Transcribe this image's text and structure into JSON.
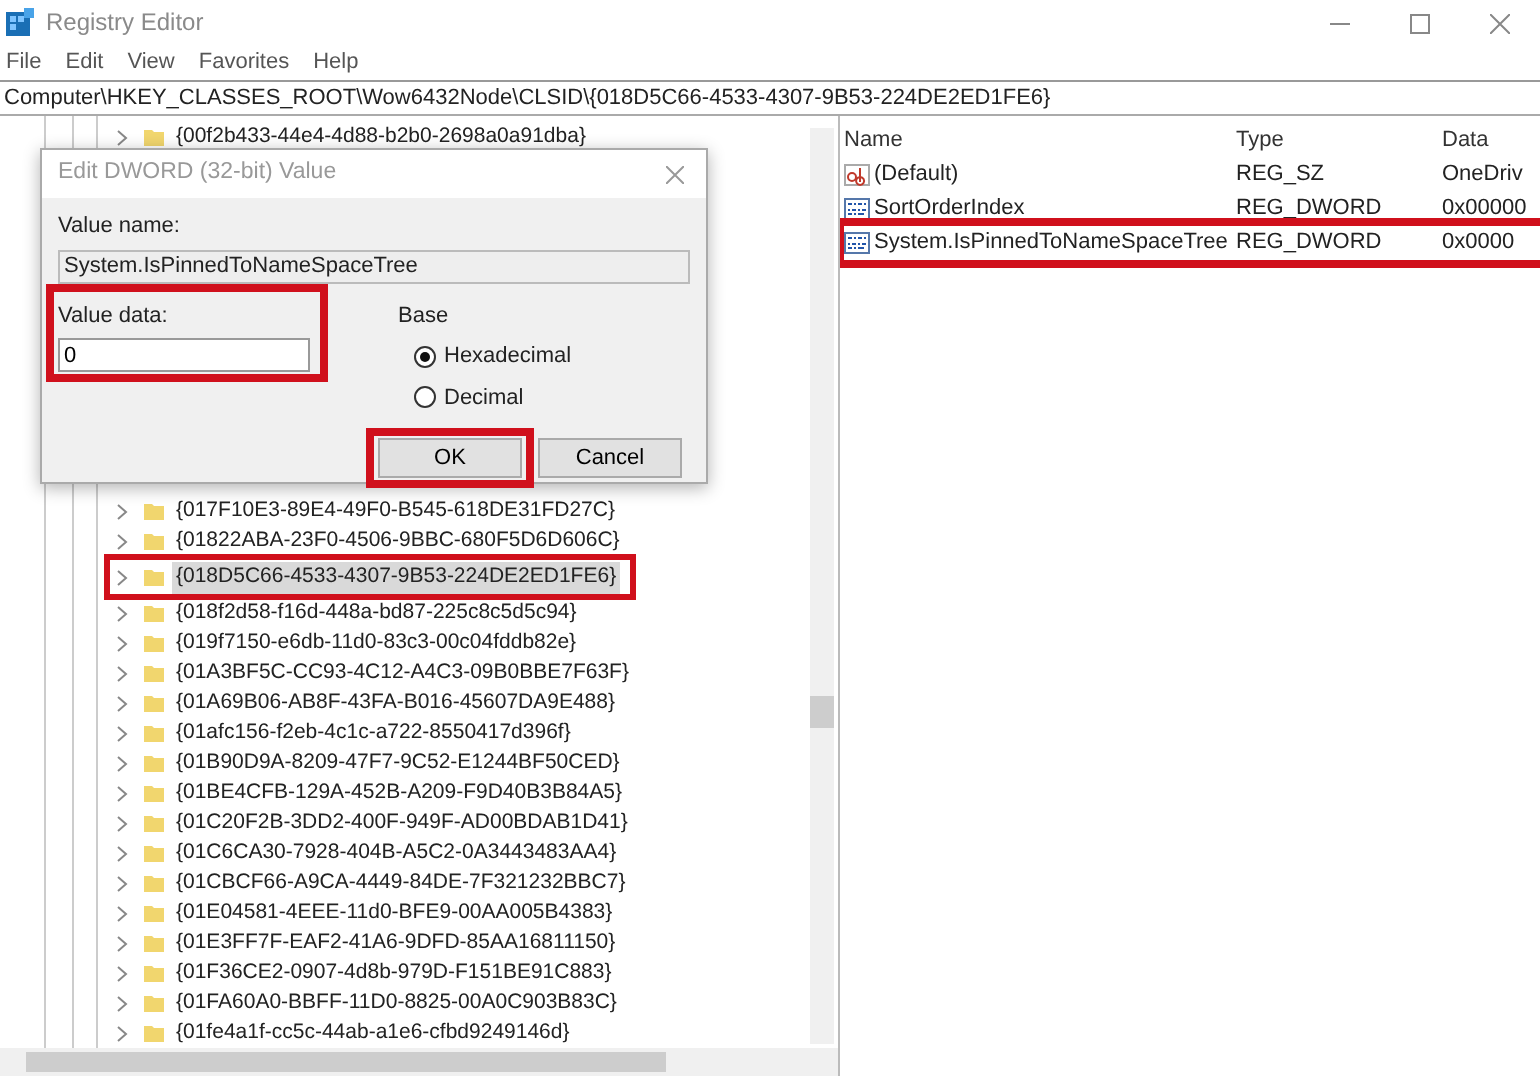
{
  "window": {
    "title": "Registry Editor"
  },
  "menu": [
    "File",
    "Edit",
    "View",
    "Favorites",
    "Help"
  ],
  "address": "Computer\\HKEY_CLASSES_ROOT\\Wow6432Node\\CLSID\\{018D5C66-4533-4307-9B53-224DE2ED1FE6}",
  "tree": [
    {
      "label": "{00f2b433-44e4-4d88-b2b0-2698a0a91dba}",
      "selected": false,
      "highlighted": false
    },
    {
      "label": "{017F10E3-89E4-49F0-B545-618DE31FD27C}",
      "selected": false,
      "highlighted": false
    },
    {
      "label": "{01822ABA-23F0-4506-9BBC-680F5D6D606C}",
      "selected": false,
      "highlighted": false
    },
    {
      "label": "{018D5C66-4533-4307-9B53-224DE2ED1FE6}",
      "selected": true,
      "highlighted": true
    },
    {
      "label": "{018f2d58-f16d-448a-bd87-225c8c5d5c94}",
      "selected": false,
      "highlighted": false
    },
    {
      "label": "{019f7150-e6db-11d0-83c3-00c04fddb82e}",
      "selected": false,
      "highlighted": false
    },
    {
      "label": "{01A3BF5C-CC93-4C12-A4C3-09B0BBE7F63F}",
      "selected": false,
      "highlighted": false
    },
    {
      "label": "{01A69B06-AB8F-43FA-B016-45607DA9E488}",
      "selected": false,
      "highlighted": false
    },
    {
      "label": "{01afc156-f2eb-4c1c-a722-8550417d396f}",
      "selected": false,
      "highlighted": false
    },
    {
      "label": "{01B90D9A-8209-47F7-9C52-E1244BF50CED}",
      "selected": false,
      "highlighted": false
    },
    {
      "label": "{01BE4CFB-129A-452B-A209-F9D40B3B84A5}",
      "selected": false,
      "highlighted": false
    },
    {
      "label": "{01C20F2B-3DD2-400F-949F-AD00BDAB1D41}",
      "selected": false,
      "highlighted": false
    },
    {
      "label": "{01C6CA30-7928-404B-A5C2-0A3443483AA4}",
      "selected": false,
      "highlighted": false
    },
    {
      "label": "{01CBCF66-A9CA-4449-84DE-7F321232BBC7}",
      "selected": false,
      "highlighted": false
    },
    {
      "label": "{01E04581-4EEE-11d0-BFE9-00AA005B4383}",
      "selected": false,
      "highlighted": false
    },
    {
      "label": "{01E3FF7F-EAF2-41A6-9DFD-85AA16811150}",
      "selected": false,
      "highlighted": false
    },
    {
      "label": "{01F36CE2-0907-4d8b-979D-F151BE91C883}",
      "selected": false,
      "highlighted": false
    },
    {
      "label": "{01FA60A0-BBFF-11D0-8825-00A0C903B83C}",
      "selected": false,
      "highlighted": false
    },
    {
      "label": "{01fe4a1f-cc5c-44ab-a1e6-cfbd9249146d}",
      "selected": false,
      "highlighted": false
    }
  ],
  "values": {
    "columns": [
      "Name",
      "Type",
      "Data"
    ],
    "rows": [
      {
        "kind": "string",
        "name": "(Default)",
        "type": "REG_SZ",
        "data": "OneDriv",
        "highlighted": false
      },
      {
        "kind": "binary",
        "name": "SortOrderIndex",
        "type": "REG_DWORD",
        "data": "0x00000",
        "highlighted": false
      },
      {
        "kind": "binary",
        "name": "System.IsPinnedToNameSpaceTree",
        "type": "REG_DWORD",
        "data": "0x0000",
        "highlighted": true
      }
    ]
  },
  "dialog": {
    "title": "Edit DWORD (32-bit) Value",
    "value_name_label": "Value name:",
    "value_name": "System.IsPinnedToNameSpaceTree",
    "value_data_label": "Value data:",
    "value_data": "0",
    "value_data_highlighted": true,
    "base_label": "Base",
    "bases": [
      {
        "label": "Hexadecimal",
        "selected": true
      },
      {
        "label": "Decimal",
        "selected": false
      }
    ],
    "buttons": [
      {
        "label": "OK",
        "highlighted": true
      },
      {
        "label": "Cancel",
        "highlighted": false
      }
    ]
  }
}
